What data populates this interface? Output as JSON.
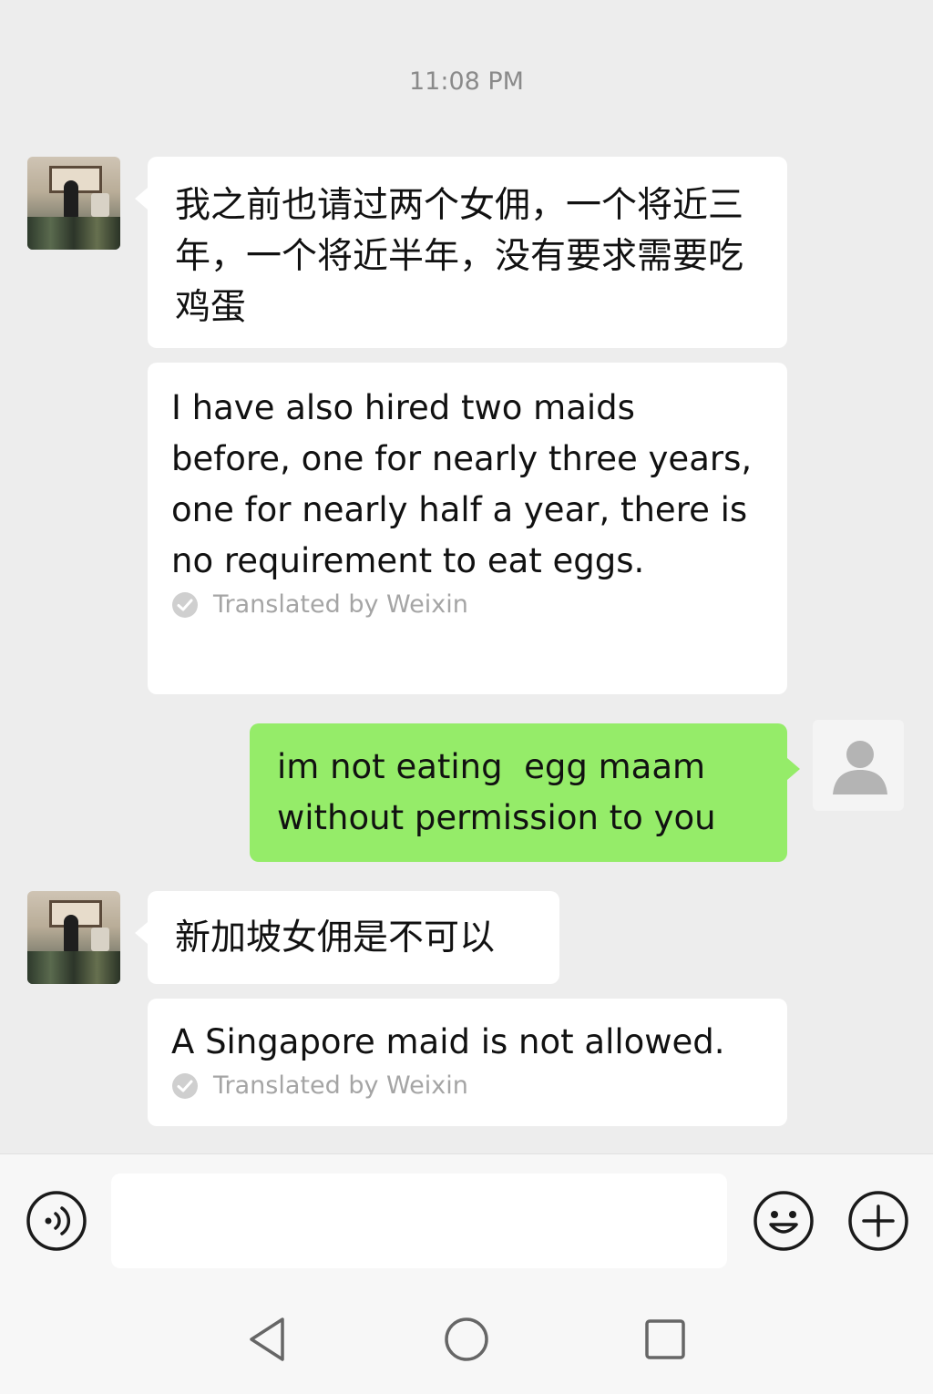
{
  "chat": {
    "timestamp": "11:08 PM",
    "messages": [
      {
        "sender": "other",
        "text": "我之前也请过两个女佣，一个将近三年，一个将近半年，没有要求需要吃鸡蛋",
        "translation": "I have also hired two maids before, one for nearly three years, one for nearly half a year, there is no requirement to eat eggs.",
        "translation_note": "Translated by Weixin"
      },
      {
        "sender": "me",
        "text": "im not eating  egg maam without permission to you"
      },
      {
        "sender": "other",
        "text": "新加坡女佣是不可以",
        "translation": "A Singapore maid is not allowed.",
        "translation_note": "Translated by Weixin"
      }
    ]
  },
  "input_bar": {
    "voice_icon": "voice-input-icon",
    "emoji_icon": "emoji-icon",
    "plus_icon": "plus-icon",
    "text_value": ""
  },
  "nav_bar": {
    "back_icon": "back-triangle-icon",
    "home_icon": "home-circle-icon",
    "recent_icon": "recent-square-icon"
  },
  "colors": {
    "background": "#ededed",
    "sent_bubble": "#95ec69",
    "received_bubble": "#ffffff",
    "muted_text": "#a5a5a5"
  }
}
